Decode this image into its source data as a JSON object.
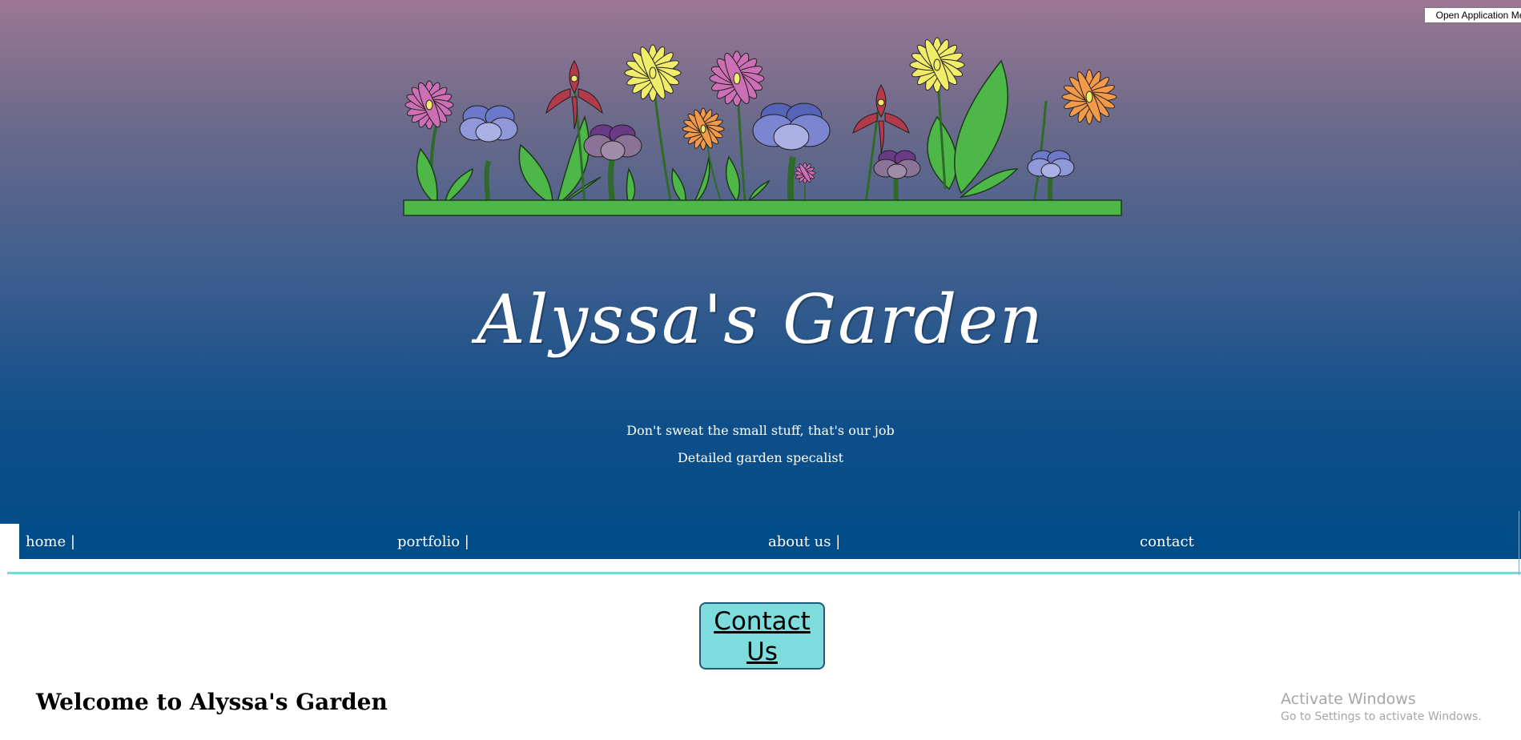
{
  "system": {
    "open_app_button": "Open Application Me"
  },
  "header": {
    "title": "Alyssa's Garden",
    "tagline": "Don't sweat the small stuff, that's our job",
    "subtitle": "Detailed garden specalist"
  },
  "nav": {
    "home": "home |",
    "portfolio": "portfolio |",
    "about": "about us |",
    "contact": "contact"
  },
  "cta": {
    "line1": "Contact",
    "line2": "Us"
  },
  "main": {
    "welcome": "Welcome to Alyssa's Garden"
  },
  "watermark": {
    "title": "Activate Windows",
    "subtitle": "Go to Settings to activate Windows."
  },
  "colors": {
    "gradient_top": "#9c7694",
    "gradient_bottom": "#004c88",
    "nav_bg": "#004c88",
    "accent_teal": "#7edcdc",
    "grass": "#4db848"
  }
}
